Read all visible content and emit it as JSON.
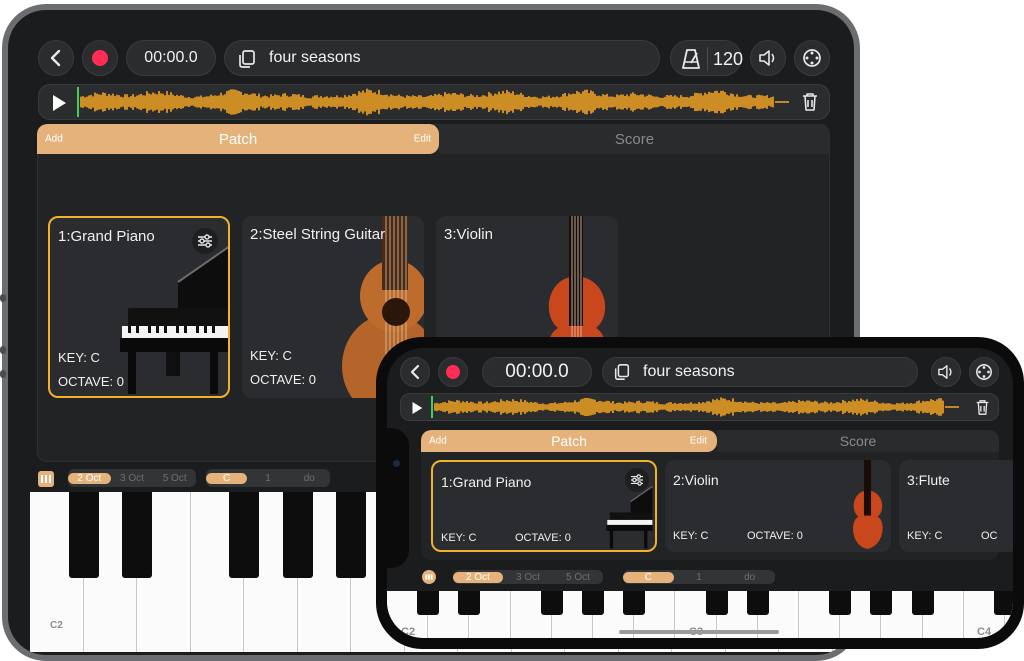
{
  "project": {
    "name": "four seasons",
    "time": "00:00.0",
    "tempo": "120"
  },
  "tabs": {
    "patch": "Patch",
    "score": "Score",
    "add": "Add",
    "edit": "Edit"
  },
  "tablet": {
    "patches": [
      {
        "title": "1:Grand Piano",
        "key": "KEY: C",
        "octave": "OCTAVE: 0"
      },
      {
        "title": "2:Steel String Guitar",
        "key": "KEY: C",
        "octave": "OCTAVE: 0"
      },
      {
        "title": "3:Violin"
      }
    ],
    "octaves": [
      "2 Oct",
      "3 Oct",
      "5 Oct"
    ],
    "keymode": [
      "C",
      "1",
      "do"
    ],
    "key_label_left": "C2"
  },
  "phone": {
    "patches": [
      {
        "title": "1:Grand Piano",
        "key": "KEY: C",
        "octave": "OCTAVE: 0"
      },
      {
        "title": "2:Violin",
        "key": "KEY: C",
        "octave": "OCTAVE: 0"
      },
      {
        "title": "3:Flute",
        "key": "KEY: C",
        "octave": "OC"
      }
    ],
    "octaves": [
      "2 Oct",
      "3 Oct",
      "5 Oct"
    ],
    "keymode": [
      "C",
      "1",
      "do"
    ],
    "key_labels": [
      "C2",
      "C3",
      "C4"
    ]
  },
  "colors": {
    "accent": "#e5b27c",
    "waveform": "#f5a623",
    "record": "#ff2d55",
    "selected_border": "#f0b22a",
    "playhead": "#3fd05a"
  },
  "icons": {
    "back": "chevron-left-icon",
    "record": "record-icon",
    "copy": "copy-icon",
    "metronome": "metronome-icon",
    "volume": "speaker-icon",
    "settings": "dial-icon",
    "play": "play-icon",
    "delete": "trash-icon",
    "keyboard": "keyboard-icon",
    "adjust": "sliders-icon"
  }
}
